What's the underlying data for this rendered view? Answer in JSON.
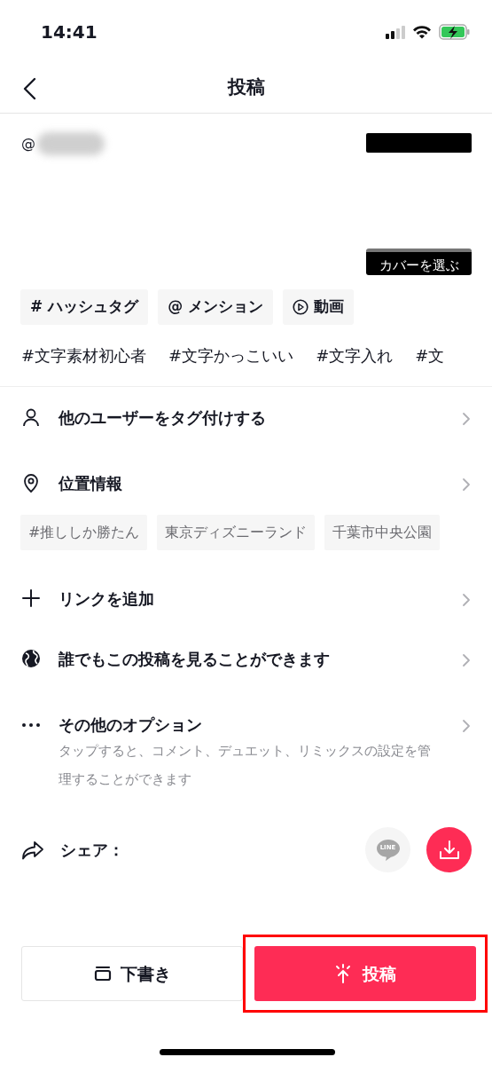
{
  "status_bar": {
    "time": "14:41"
  },
  "header": {
    "title": "投稿"
  },
  "caption": {
    "mention_prefix": "@",
    "cover_button": "カバーを選ぶ"
  },
  "insert_chips": [
    {
      "kind": "hashtag",
      "icon": "#",
      "label": "ハッシュタグ"
    },
    {
      "kind": "mention",
      "icon": "@",
      "label": "メンション"
    },
    {
      "kind": "video",
      "label": "動画"
    }
  ],
  "suggested_hashtags": [
    "#文字素材初心者",
    "#文字かっこいい",
    "#文字入れ",
    "#文"
  ],
  "settings": [
    {
      "kind": "person",
      "label": "他のユーザーをタグ付けする"
    },
    {
      "kind": "location",
      "label": "位置情報",
      "chips": [
        "#推ししか勝たん",
        "東京ディズニーランド",
        "千葉市中央公園"
      ]
    },
    {
      "kind": "plus",
      "label": "リンクを追加"
    },
    {
      "kind": "globe",
      "label": "誰でもこの投稿を見ることができます"
    },
    {
      "kind": "more",
      "label": "その他のオプション",
      "description": "タップすると、コメント、デュエット、リミックスの設定を管理することができます"
    }
  ],
  "share": {
    "label": "シェア：",
    "options": [
      {
        "kind": "line",
        "label": "LINE"
      },
      {
        "kind": "download"
      }
    ]
  },
  "buttons": [
    {
      "kind": "draft",
      "label": "下書き",
      "highlighted": false
    },
    {
      "kind": "post",
      "label": "投稿",
      "highlighted": true
    }
  ]
}
